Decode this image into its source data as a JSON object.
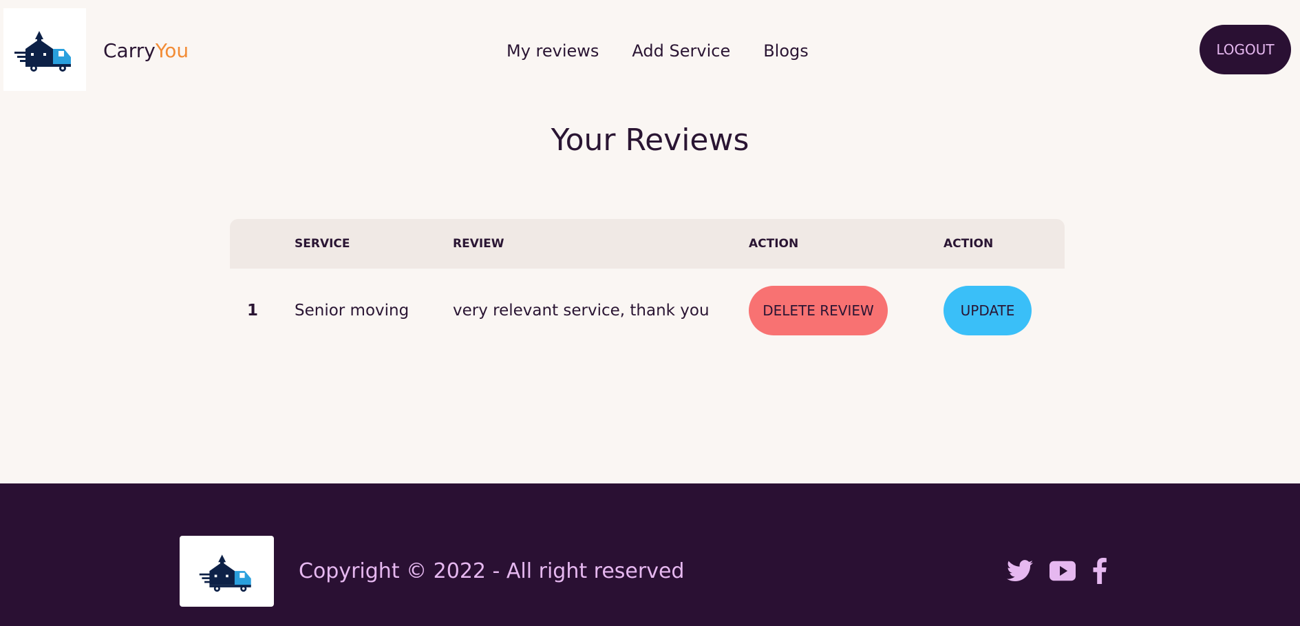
{
  "header": {
    "brand_main": "Carry",
    "brand_accent": "You",
    "nav": [
      "My reviews",
      "Add Service",
      "Blogs"
    ],
    "logout_label": "LOGOUT"
  },
  "page": {
    "title": "Your Reviews"
  },
  "table": {
    "headers": [
      "",
      "SERVICE",
      "REVIEW",
      "ACTION",
      "ACTION"
    ],
    "rows": [
      {
        "index": "1",
        "service": "Senior moving",
        "review": "very relevant service, thank you",
        "delete_label": "DELETE REVIEW",
        "update_label": "UPDATE"
      }
    ]
  },
  "footer": {
    "copyright": "Copyright © 2022 - All right reserved",
    "social_icons": [
      "twitter-icon",
      "youtube-icon",
      "facebook-icon"
    ]
  },
  "colors": {
    "background": "#faf6f3",
    "primary_dark": "#2a1033",
    "accent_orange": "#f28c36",
    "delete_red": "#f87272",
    "update_blue": "#3abff8",
    "footer_text": "#e6b8f0"
  }
}
